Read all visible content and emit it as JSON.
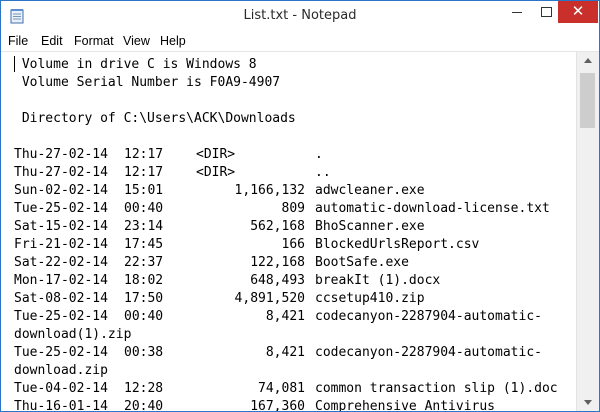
{
  "window": {
    "title": "List.txt - Notepad",
    "controls": {
      "minimize_icon": "minimize-icon",
      "maximize_icon": "maximize-icon",
      "close_glyph": "✕"
    }
  },
  "menu": [
    "File",
    "Edit",
    "Format",
    "View",
    "Help"
  ],
  "document": {
    "header": [
      " Volume in drive C is Windows 8",
      " Volume Serial Number is F0A9-4907",
      "",
      " Directory of C:\\Users\\ACK\\Downloads",
      ""
    ],
    "rows": [
      {
        "day": "Thu-27-02-14",
        "time": "12:17",
        "dir": "<DIR>",
        "size": "",
        "name": "."
      },
      {
        "day": "Thu-27-02-14",
        "time": "12:17",
        "dir": "<DIR>",
        "size": "",
        "name": ".."
      },
      {
        "day": "Sun-02-02-14",
        "time": "15:01",
        "dir": "",
        "size": "1,166,132",
        "name": "adwcleaner.exe"
      },
      {
        "day": "Tue-25-02-14",
        "time": "00:40",
        "dir": "",
        "size": "809",
        "name": "automatic-download-license.txt"
      },
      {
        "day": "Sat-15-02-14",
        "time": "23:14",
        "dir": "",
        "size": "562,168",
        "name": "BhoScanner.exe"
      },
      {
        "day": "Fri-21-02-14",
        "time": "17:45",
        "dir": "",
        "size": "166",
        "name": "BlockedUrlsReport.csv"
      },
      {
        "day": "Sat-22-02-14",
        "time": "22:37",
        "dir": "",
        "size": "122,168",
        "name": "BootSafe.exe"
      },
      {
        "day": "Mon-17-02-14",
        "time": "18:02",
        "dir": "",
        "size": "648,493",
        "name": "breakIt (1).docx"
      },
      {
        "day": "Sat-08-02-14",
        "time": "17:50",
        "dir": "",
        "size": "4,891,520",
        "name": "ccsetup410.zip"
      },
      {
        "day": "Tue-25-02-14",
        "time": "00:40",
        "dir": "",
        "size": "8,421",
        "name": "codecanyon-2287904-automatic-"
      },
      {
        "wrap": "download(1).zip"
      },
      {
        "day": "Tue-25-02-14",
        "time": "00:38",
        "dir": "",
        "size": "8,421",
        "name": "codecanyon-2287904-automatic-"
      },
      {
        "wrap": "download.zip"
      },
      {
        "day": "Tue-04-02-14",
        "time": "12:28",
        "dir": "",
        "size": "74,081",
        "name": "common transaction slip (1).doc"
      },
      {
        "day": "Thu-16-01-14",
        "time": "20:40",
        "dir": "",
        "size": "167,360",
        "name": "Comprehensive Antivirus"
      }
    ]
  }
}
